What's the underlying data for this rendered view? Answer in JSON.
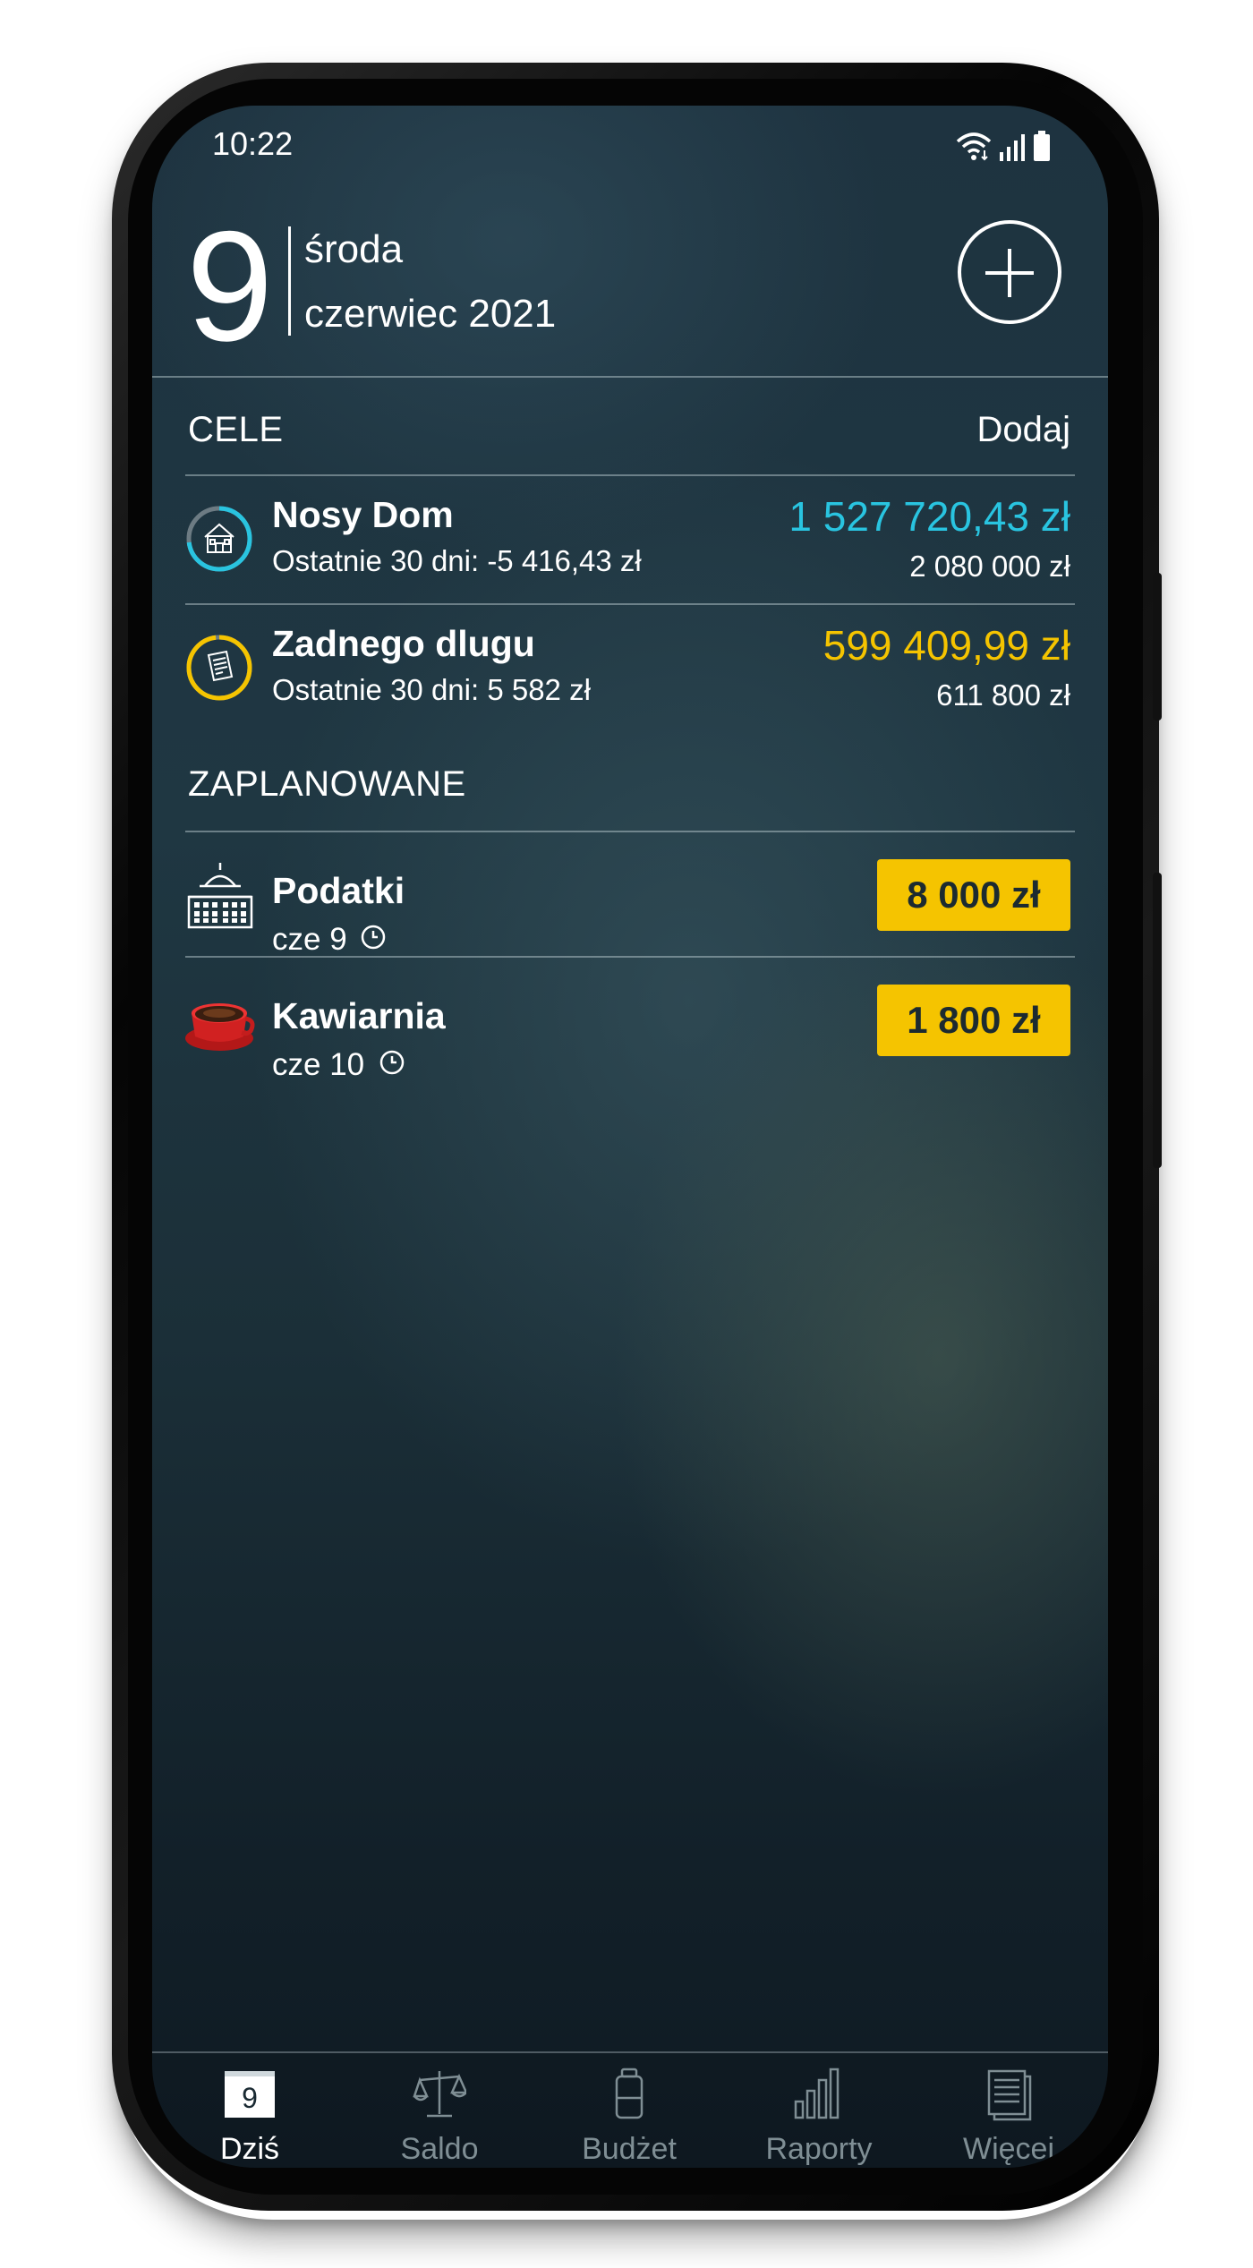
{
  "status_bar": {
    "time": "10:22",
    "icons": [
      "wifi-icon",
      "signal-icon",
      "battery-icon"
    ]
  },
  "header": {
    "day_number": "9",
    "weekday": "środa",
    "month_year": "czerwiec 2021",
    "add_icon": "plus-icon"
  },
  "goals": {
    "title": "CELE",
    "action_label": "Dodaj",
    "items": [
      {
        "name": "Nosy Dom",
        "subtitle": "Ostatnie 30 dni: -5 416,43 zł",
        "amount": "1 527 720,43 zł",
        "target": "2 080 000 zł",
        "color": "#29c4e0",
        "progress": 0.73,
        "icon": "house-icon"
      },
      {
        "name": "Zadnego dlugu",
        "subtitle": "Ostatnie 30 dni: 5 582 zł",
        "amount": "599 409,99 zł",
        "target": "611 800 zł",
        "color": "#f5c400",
        "progress": 0.98,
        "icon": "document-icon"
      }
    ]
  },
  "planned": {
    "title": "ZAPLANOWANE",
    "items": [
      {
        "name": "Podatki",
        "date": "cze 9",
        "amount": "8 000 zł",
        "icon": "government-building-icon"
      },
      {
        "name": "Kawiarnia",
        "date": "cze 10",
        "amount": "1 800 zł",
        "icon": "coffee-cup-icon"
      }
    ]
  },
  "bottom_nav": {
    "active": "Dziś",
    "calendar_day": "9",
    "items": [
      {
        "label": "Dziś",
        "icon": "calendar-icon"
      },
      {
        "label": "Saldo",
        "icon": "scales-icon"
      },
      {
        "label": "Budżet",
        "icon": "budget-jar-icon"
      },
      {
        "label": "Raporty",
        "icon": "bar-chart-icon"
      },
      {
        "label": "Więcej",
        "icon": "documents-icon"
      }
    ]
  },
  "colors": {
    "accent_cyan": "#29c4e0",
    "accent_yellow": "#f5c400",
    "nav_inactive": "#7f8e94"
  }
}
